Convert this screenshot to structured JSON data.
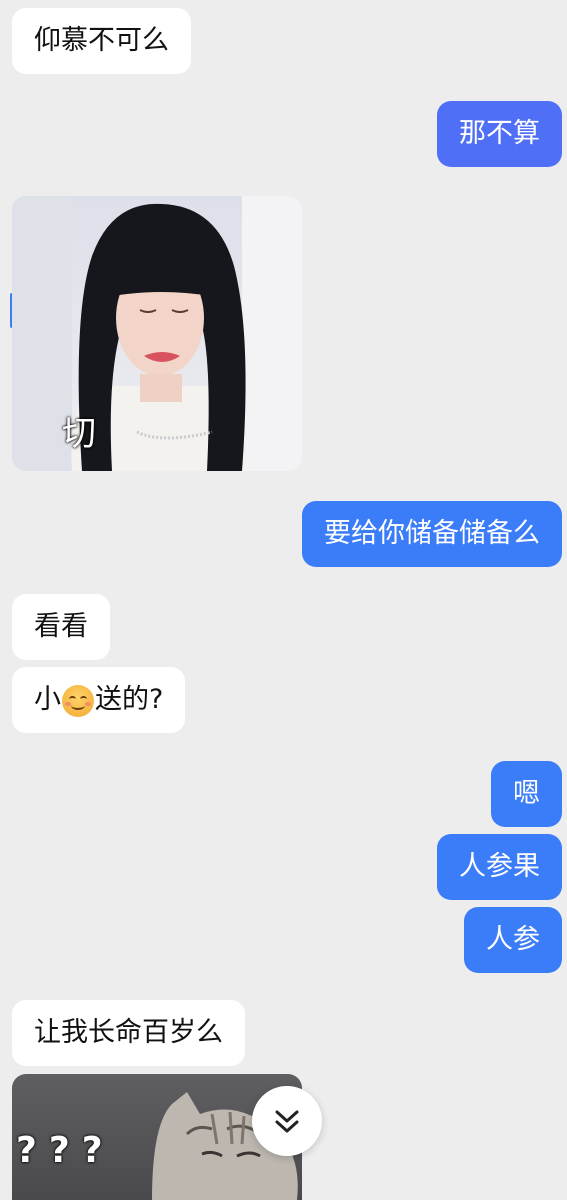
{
  "messages": {
    "m1": "仰慕不可么",
    "m2": "那不算",
    "m3": "要给你储备储备么",
    "m4": "看看",
    "m5_before": "小",
    "m5_after": "送的?",
    "m6": "嗯",
    "m7": "人参果",
    "m8": "人参",
    "m9": "让我长命百岁么"
  },
  "stickers": {
    "lisa_caption": "切",
    "cat_caption": "???"
  },
  "icons": {
    "emoji": "smiling-face-emoji",
    "scroll": "double-chevron-down-icon"
  },
  "colors": {
    "background": "#ededed",
    "incoming_bubble": "#ffffff",
    "outgoing_bubble": "#3b7cf8"
  }
}
